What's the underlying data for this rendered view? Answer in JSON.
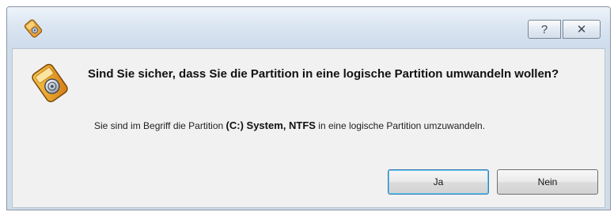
{
  "window": {
    "icon": "partition-tool-icon",
    "buttons": {
      "help_icon": "question-mark-icon",
      "help_glyph": "?",
      "close_icon": "close-icon",
      "close_glyph": "✕"
    }
  },
  "dialog": {
    "icon": "warning-disk-icon",
    "heading": "Sind Sie sicher, dass Sie die Partition in eine logische Partition umwandeln wollen?",
    "message": {
      "prefix": "Sie sind im Begriff die Partition ",
      "partition": "(C:) System, NTFS",
      "suffix": " in eine logische Partition umzuwandeln."
    },
    "buttons": {
      "yes_label": "Ja",
      "no_label": "Nein"
    }
  },
  "colors": {
    "titlebar": "#dbe6f2",
    "client": "#f1f1f1",
    "default_button_border": "#3c7fb1"
  }
}
